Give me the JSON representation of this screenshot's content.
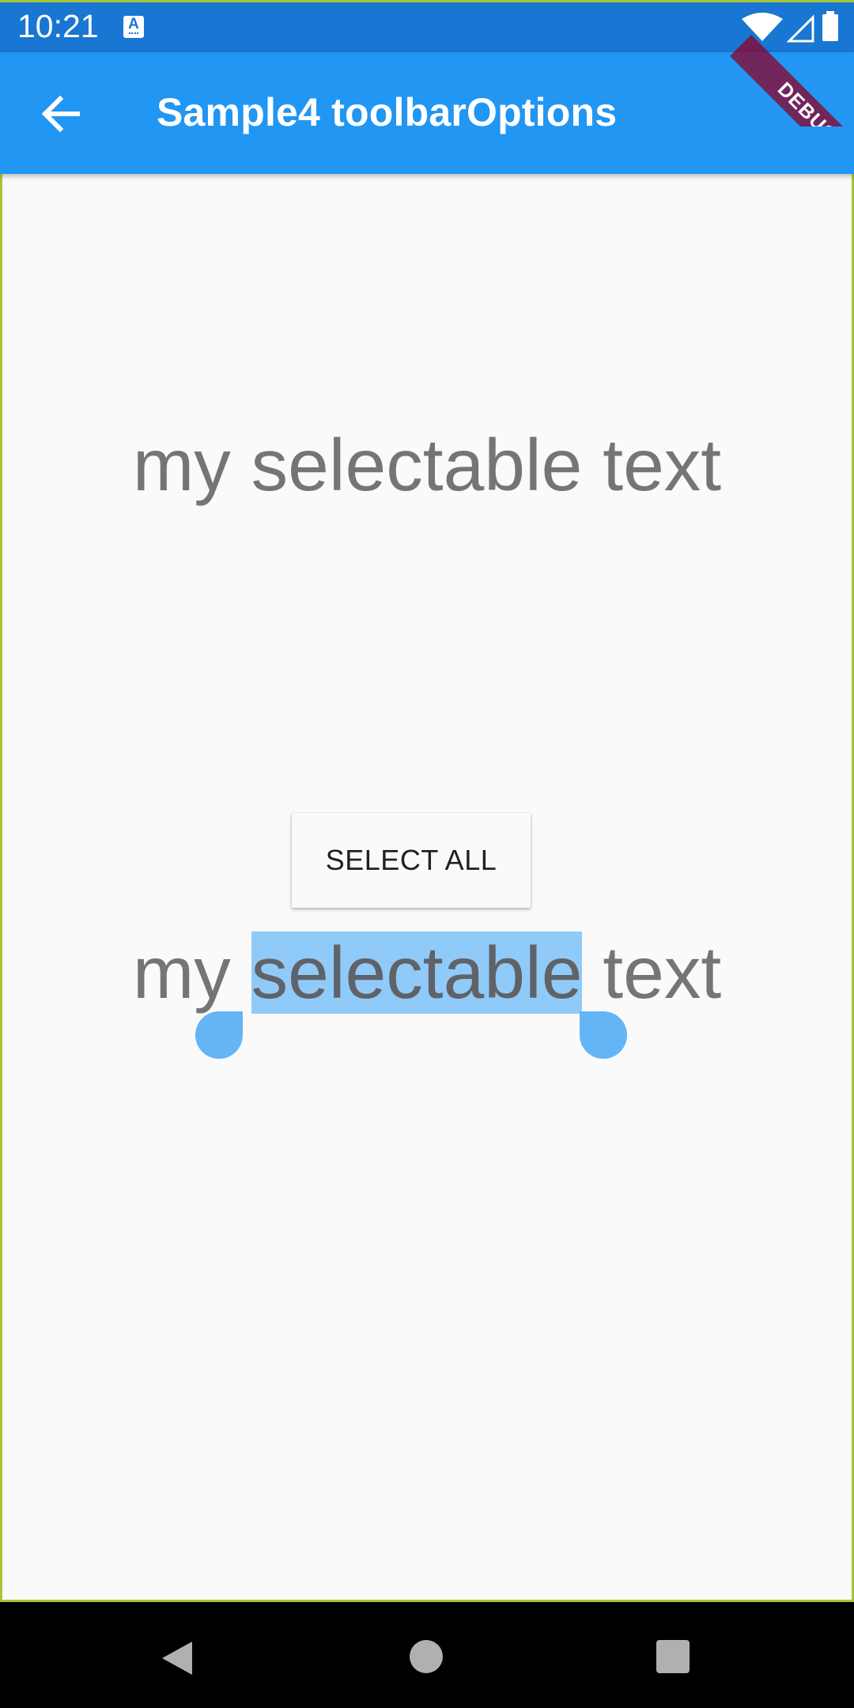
{
  "status_bar": {
    "time": "10:21",
    "app_icon_letter": "A",
    "icons": [
      "wifi-icon",
      "signal-icon",
      "battery-icon"
    ]
  },
  "app_bar": {
    "title": "Sample4 toolbarOptions",
    "back_icon": "arrow-back-icon",
    "background_color": "#2196f3"
  },
  "debug_banner": {
    "label": "DEBUG"
  },
  "content": {
    "top_text": "my selectable text",
    "bottom_text": {
      "before": "my ",
      "selected": "selectable",
      "after": " text"
    },
    "selection_color": "#90caf9",
    "handle_color": "#64b5f6"
  },
  "toolbar": {
    "select_all_label": "SELECT ALL"
  },
  "nav_bar": {
    "buttons": [
      "back-triangle-icon",
      "home-circle-icon",
      "recents-square-icon"
    ]
  }
}
